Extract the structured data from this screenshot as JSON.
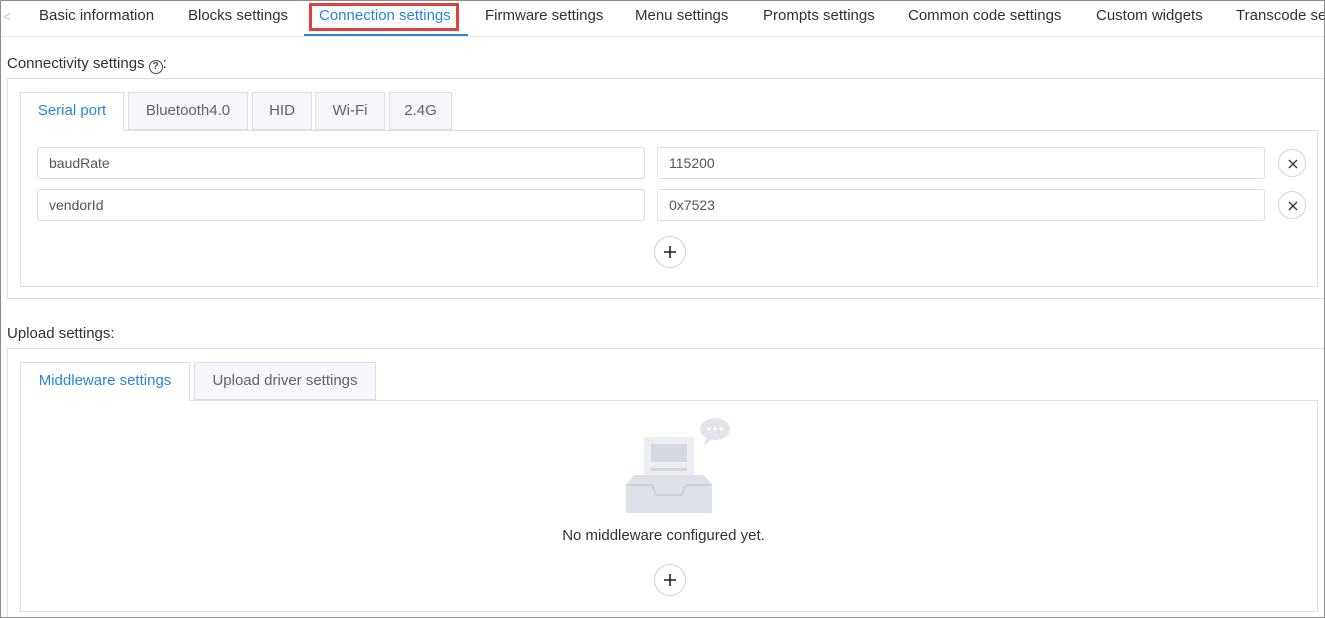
{
  "top_tabs": {
    "scroll_left_glyph": "<",
    "items": [
      {
        "label": "Basic information"
      },
      {
        "label": "Blocks settings"
      },
      {
        "label": "Connection settings"
      },
      {
        "label": "Firmware settings"
      },
      {
        "label": "Menu settings"
      },
      {
        "label": "Prompts settings"
      },
      {
        "label": "Common code settings"
      },
      {
        "label": "Custom widgets"
      },
      {
        "label": "Transcode se"
      }
    ],
    "active_index": 2
  },
  "connectivity": {
    "label": "Connectivity settings",
    "colon": ":",
    "help_glyph": "?",
    "tabs": [
      {
        "label": "Serial port"
      },
      {
        "label": "Bluetooth4.0"
      },
      {
        "label": "HID"
      },
      {
        "label": "Wi-Fi"
      },
      {
        "label": "2.4G"
      }
    ],
    "active_tab": 0,
    "params": [
      {
        "key": "baudRate",
        "value": "115200"
      },
      {
        "key": "vendorId",
        "value": "0x7523"
      }
    ],
    "remove_icon": "close-icon",
    "add_icon": "plus-icon"
  },
  "upload": {
    "label": "Upload settings",
    "colon": ":",
    "tabs": [
      {
        "label": "Middleware settings"
      },
      {
        "label": "Upload driver settings"
      }
    ],
    "active_tab": 0,
    "empty_text": "No middleware configured yet.",
    "add_icon": "plus-icon"
  },
  "colors": {
    "accent": "#2a86d8",
    "highlight_box": "#e0403b",
    "border": "#dcdfe6"
  }
}
